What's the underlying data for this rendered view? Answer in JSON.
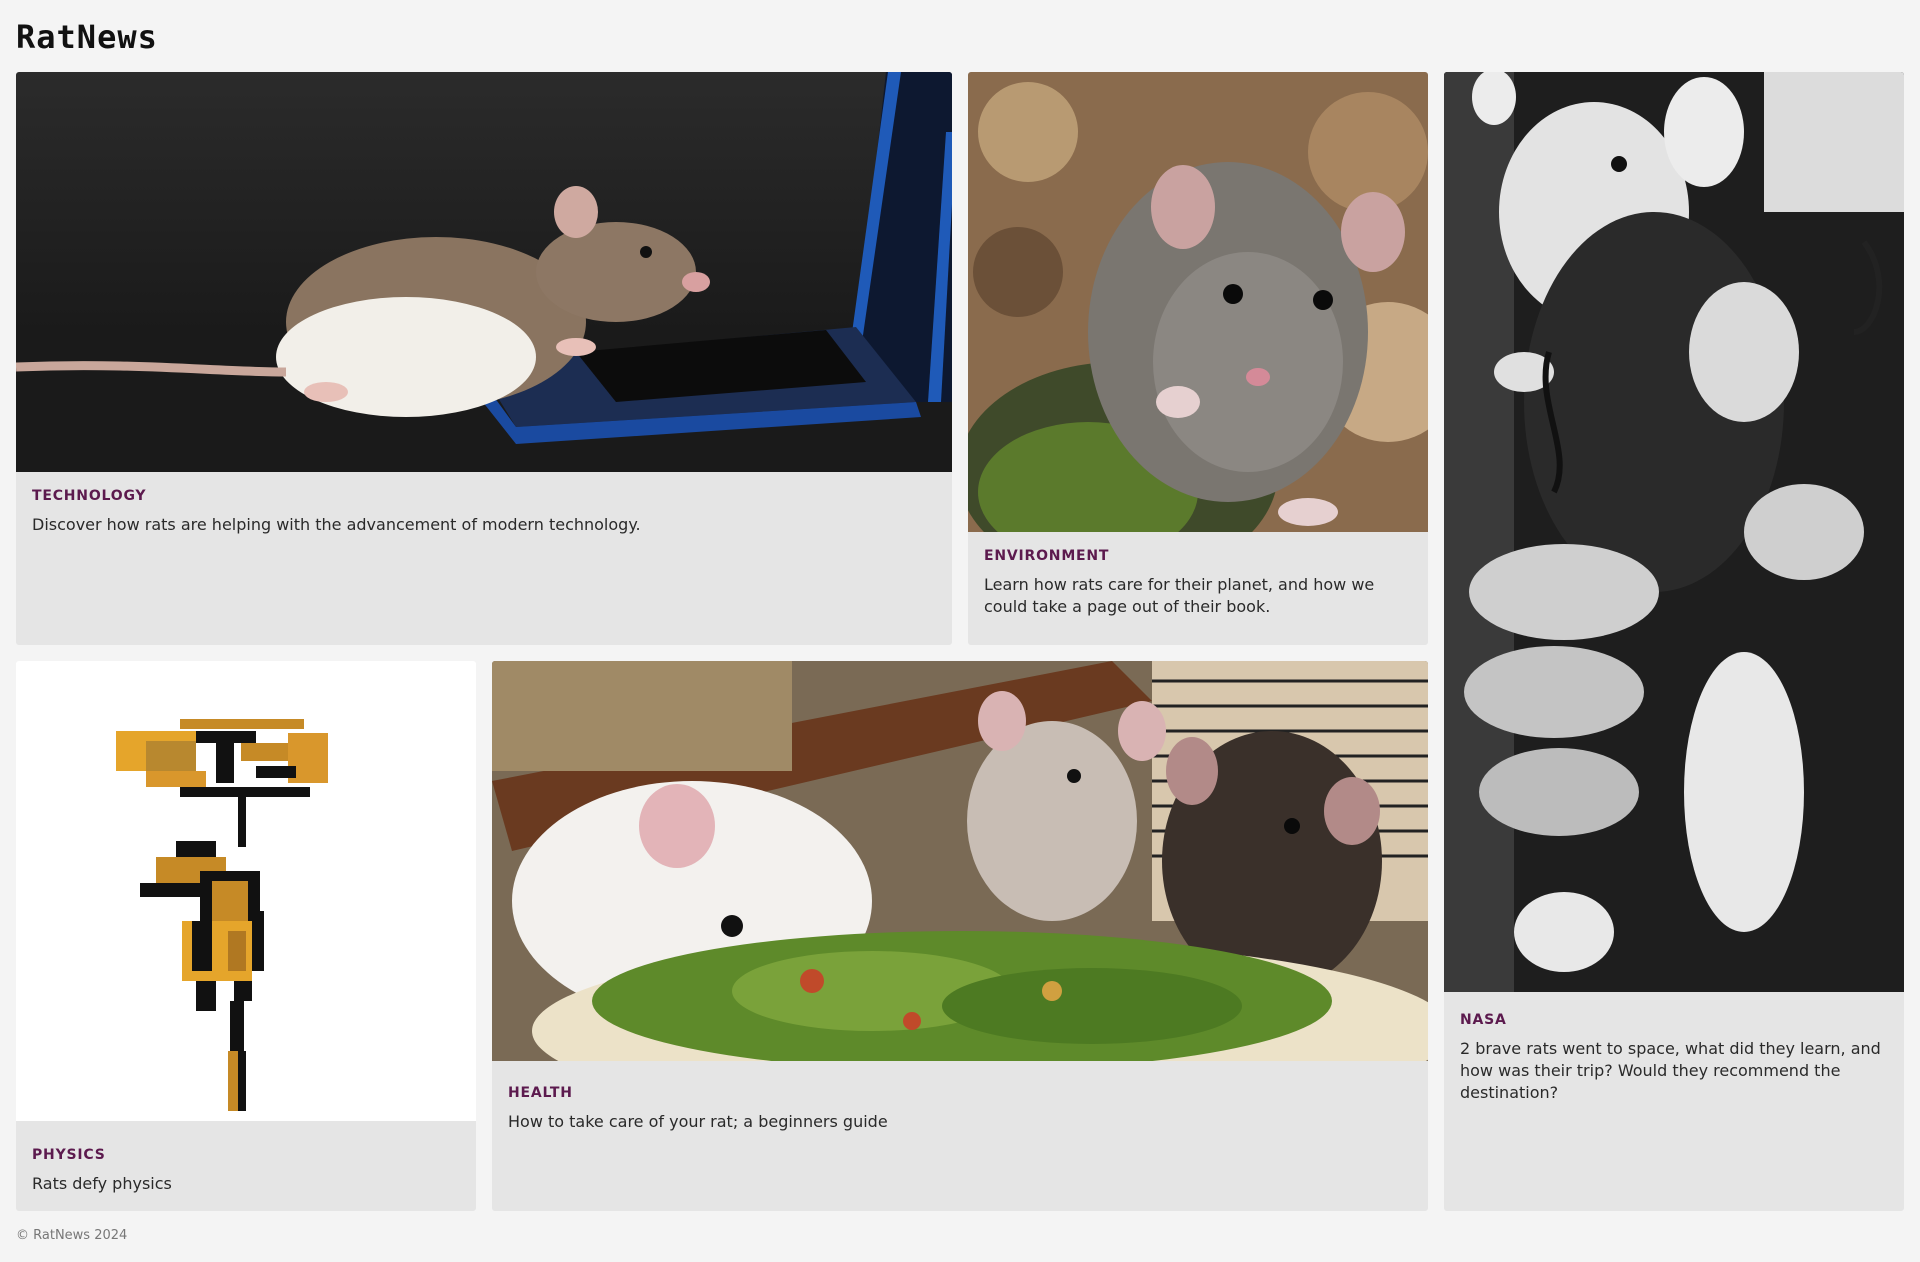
{
  "site": {
    "title": "RatNews"
  },
  "articles": [
    {
      "category": "TECHNOLOGY",
      "description": "Discover how rats are helping with the advancement of modern technology.",
      "image": "rat-on-laptop-photo"
    },
    {
      "category": "ENVIRONMENT",
      "description": "Learn how rats care for their planet, and how we could take a page out of their book.",
      "image": "rat-on-mossy-rock-photo"
    },
    {
      "category": "NASA",
      "description": "2 brave rats went to space, what did they learn, and how was their trip? Would they recommend the destination?",
      "image": "space-rat-in-hand-photo"
    },
    {
      "category": "PHYSICS",
      "description": "Rats defy physics",
      "image": "pixel-rat-propeller-art"
    },
    {
      "category": "HEALTH",
      "description": "How to take care of your rat; a beginners guide",
      "image": "rats-eating-salad-photo"
    }
  ],
  "footer": {
    "copyright": "© RatNews 2024"
  },
  "colors": {
    "background": "#f4f4f4",
    "card": "#e5e5e5",
    "category": "#5c1a4e"
  }
}
